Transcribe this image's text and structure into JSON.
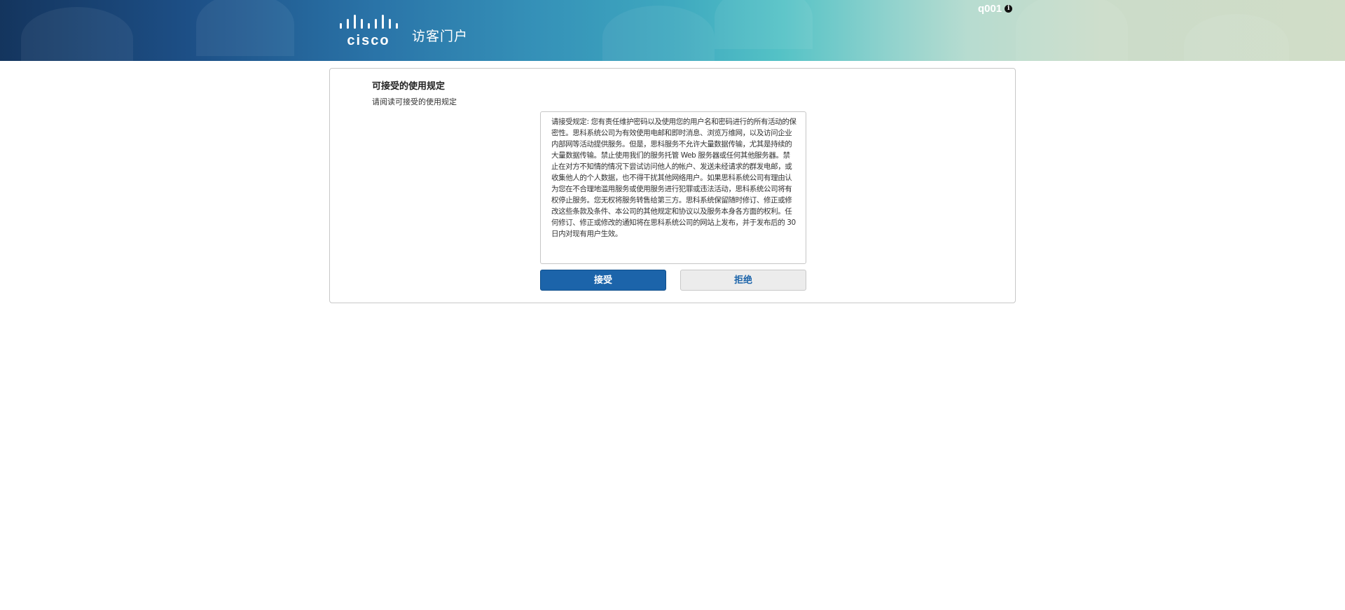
{
  "header": {
    "logo_text": "cisco",
    "portal_title": "访客门户",
    "username": "q001"
  },
  "aup": {
    "heading": "可接受的使用规定",
    "instruction": "请阅读可接受的使用规定",
    "body": "请接受规定: 您有责任维护密码以及使用您的用户名和密码进行的所有活动的保密性。思科系统公司为有效使用电邮和即时消息、浏览万维网，以及访问企业内部网等活动提供服务。但是，思科服务不允许大量数据传输，尤其是持续的大量数据传输。禁止使用我们的服务托管 Web 服务器或任何其他服务器。禁止在对方不知情的情况下尝试访问他人的帐户、发送未经请求的群发电邮，或收集他人的个人数据，也不得干扰其他网络用户。如果思科系统公司有理由认为您在不合理地滥用服务或使用服务进行犯罪或违法活动，思科系统公司将有权停止服务。您无权将服务转售给第三方。思科系统保留随时修订、修正或修改这些条款及条件、本公司的其他规定和协议以及服务本身各方面的权利。任何修订、修正或修改的通知将在思科系统公司的网站上发布，并于发布后的 30 日内对现有用户生效。",
    "accept_label": "接受",
    "decline_label": "拒绝"
  },
  "colors": {
    "accept_bg": "#1c64aa",
    "banner_dark": "#14355e",
    "banner_light": "#d1ddc8"
  }
}
